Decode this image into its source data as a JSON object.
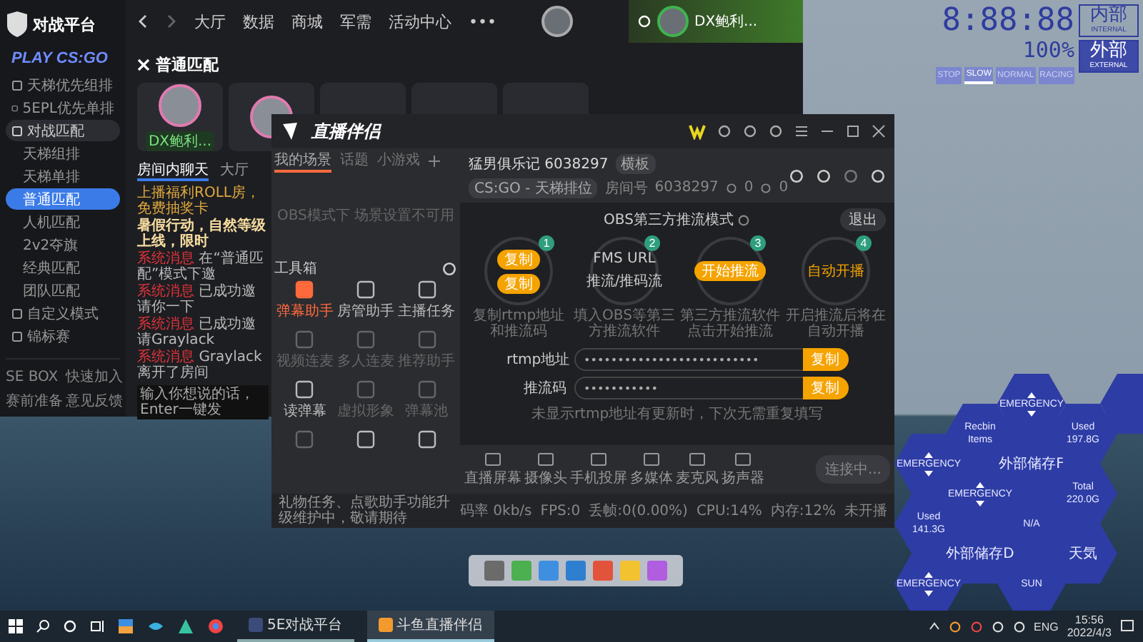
{
  "game_window": {
    "logo": "对战平台",
    "sidebar": {
      "title": "PLAY CS:GO",
      "items": [
        {
          "label": "天梯优先组排",
          "selected": false,
          "expanded": false
        },
        {
          "label": "5EPL优先单排",
          "selected": false,
          "expanded": false
        },
        {
          "label": "对战匹配",
          "selected": false,
          "expanded": true,
          "children": [
            {
              "label": "天梯组排",
              "selected": false
            },
            {
              "label": "天梯单排",
              "selected": false
            },
            {
              "label": "普通匹配",
              "selected": true
            },
            {
              "label": "人机匹配",
              "selected": false
            },
            {
              "label": "2v2夺旗",
              "selected": false
            },
            {
              "label": "经典匹配",
              "selected": false
            },
            {
              "label": "团队匹配",
              "selected": false
            }
          ]
        },
        {
          "label": "自定义模式",
          "selected": false,
          "expanded": false
        },
        {
          "label": "锦标赛",
          "selected": false,
          "expanded": false
        }
      ],
      "footer_links": [
        "SE BOX",
        "快速加入",
        "赛前准备",
        "意见反馈"
      ]
    },
    "nav": [
      "大厅",
      "数据",
      "商城",
      "军需",
      "活动中心"
    ],
    "more": "•••",
    "username": "DX鲍利...",
    "room": {
      "title": "普通匹配",
      "players": [
        {
          "kind": "player",
          "name": "DX鲍利..."
        },
        {
          "kind": "player"
        },
        {
          "kind": "empty"
        },
        {
          "kind": "empty"
        },
        {
          "kind": "empty"
        }
      ]
    },
    "chat": {
      "tabs": [
        {
          "label": "房间内聊天",
          "selected": true
        },
        {
          "label": "大厅",
          "selected": false
        }
      ],
      "messages": [
        {
          "kind": "notice",
          "text": "上播福利ROLL房，免费抽奖卡"
        },
        {
          "kind": "highlight",
          "text": "暑假行动，自然等级上线，限时"
        },
        {
          "kind": "system",
          "tag": "系统消息",
          "text": "在“普通匹配”模式下邀"
        },
        {
          "kind": "system",
          "tag": "系统消息",
          "text": "已成功邀请你一下"
        },
        {
          "kind": "system",
          "tag": "系统消息",
          "text": "已成功邀请Graylack"
        },
        {
          "kind": "system",
          "tag": "系统消息",
          "text": "Graylack 离开了房间"
        }
      ],
      "placeholder": "输入你想说的话，Enter一键发"
    }
  },
  "speed_widget": {
    "clock": "8:88:88",
    "percent": "100%",
    "modes": [
      {
        "label": "STOP",
        "selected": false
      },
      {
        "label": "SLOW",
        "selected": true
      },
      {
        "label": "NORMAL",
        "selected": false
      },
      {
        "label": "RACING",
        "selected": false
      }
    ],
    "internal": {
      "title": "内部",
      "subtitle": "INTERNAL",
      "selected": false
    },
    "external": {
      "title": "外部",
      "subtitle": "EXTERNAL",
      "selected": true
    }
  },
  "hex_widget": {
    "tiles": [
      {
        "kind": "emergency",
        "label": "EMERGENCY"
      },
      {
        "kind": "blank"
      },
      {
        "kind": "info",
        "lines": [
          "Recbin",
          "Items"
        ]
      },
      {
        "kind": "info",
        "lines": [
          "Used",
          "197.8G"
        ]
      },
      {
        "kind": "info",
        "lines": [
          "外部储存F"
        ]
      },
      {
        "kind": "emergency",
        "label": "EMERGENCY"
      },
      {
        "kind": "emergency",
        "label": "EMERGENCY"
      },
      {
        "kind": "info",
        "lines": [
          "Total",
          "220.0G"
        ]
      },
      {
        "kind": "info",
        "lines": [
          "Used",
          "141.3G"
        ]
      },
      {
        "kind": "info",
        "lines": [
          "N/A"
        ]
      },
      {
        "kind": "info",
        "lines": [
          "外部储存D"
        ]
      },
      {
        "kind": "info",
        "lines": [
          "天気"
        ]
      },
      {
        "kind": "emergency",
        "label": "EMERGENCY"
      },
      {
        "kind": "info",
        "lines": [
          "SUN"
        ]
      }
    ]
  },
  "stream_window": {
    "title": "直播伴侣",
    "scene_tabs": [
      {
        "label": "我的场景",
        "selected": true
      },
      {
        "label": "话题",
        "selected": false
      },
      {
        "label": "小游戏",
        "selected": false
      }
    ],
    "scene_placeholder": "OBS模式下 场景设置不可用",
    "toolbox_title": "工具箱",
    "tools": [
      {
        "label": "弹幕助手",
        "disabled": false,
        "active": true
      },
      {
        "label": "房管助手",
        "disabled": false,
        "active": false
      },
      {
        "label": "主播任务",
        "disabled": false,
        "active": false
      },
      {
        "label": "视频连麦",
        "disabled": true,
        "active": false
      },
      {
        "label": "多人连麦",
        "disabled": true,
        "active": false
      },
      {
        "label": "推荐助手",
        "disabled": true,
        "active": false
      },
      {
        "label": "读弹幕",
        "disabled": false,
        "active": false
      },
      {
        "label": "虚拟形象",
        "disabled": true,
        "active": false
      },
      {
        "label": "弹幕池",
        "disabled": true,
        "active": false
      },
      {
        "disabled": true,
        "active": false
      },
      {
        "disabled": false,
        "active": false
      },
      {
        "disabled": false,
        "active": false
      }
    ],
    "room_name": "猛男俱乐记 6038297",
    "room_tag": "横板",
    "category": "CS:GO - 天梯排位",
    "room_id_label": "房间号",
    "room_id": "6038297",
    "heat": "0",
    "viewers": "0",
    "mode_title": "OBS第三方推流模式",
    "exit": "退出",
    "steps": [
      {
        "number": "1",
        "kind": "copy",
        "buttons": [
          "复制",
          "复制"
        ],
        "caption": "复制rtmp地址和推流码"
      },
      {
        "number": "2",
        "kind": "text",
        "lines": [
          "FMS URL",
          "推流/推码流"
        ],
        "caption": "填入OBS等第三方推流软件"
      },
      {
        "number": "3",
        "kind": "button",
        "button": "开始推流",
        "caption": "第三方推流软件点击开始推流"
      },
      {
        "number": "4",
        "kind": "label",
        "label": "自动开播",
        "caption": "开启推流后将在自动开播"
      }
    ],
    "fields": [
      {
        "label": "rtmp地址",
        "value": "••••••••••••••••••••••••••",
        "button": "复制"
      },
      {
        "label": "推流码",
        "value": "•••••••••••",
        "button": "复制"
      }
    ],
    "note": "未显示rtmp地址有更新时，下次无需重复填写",
    "toolbar": [
      "直播屏幕",
      "摄像头",
      "手机投屏",
      "多媒体",
      "麦克风",
      "扬声器"
    ],
    "connect": "连接中...",
    "status_message": "礼物任务、点歌助手功能升级维护中，敬请期待",
    "stats": [
      "码率 0kb/s",
      "FPS:0",
      "丢帧:0(0.00%)",
      "CPU:14%",
      "内存:12%",
      "未开播"
    ]
  },
  "taskbar": {
    "apps": [
      {
        "label": "5E对战平台",
        "selected": false
      },
      {
        "label": "斗鱼直播伴侣",
        "selected": true
      }
    ],
    "language": "ENG",
    "time": "15:56",
    "date": "2022/4/3"
  }
}
